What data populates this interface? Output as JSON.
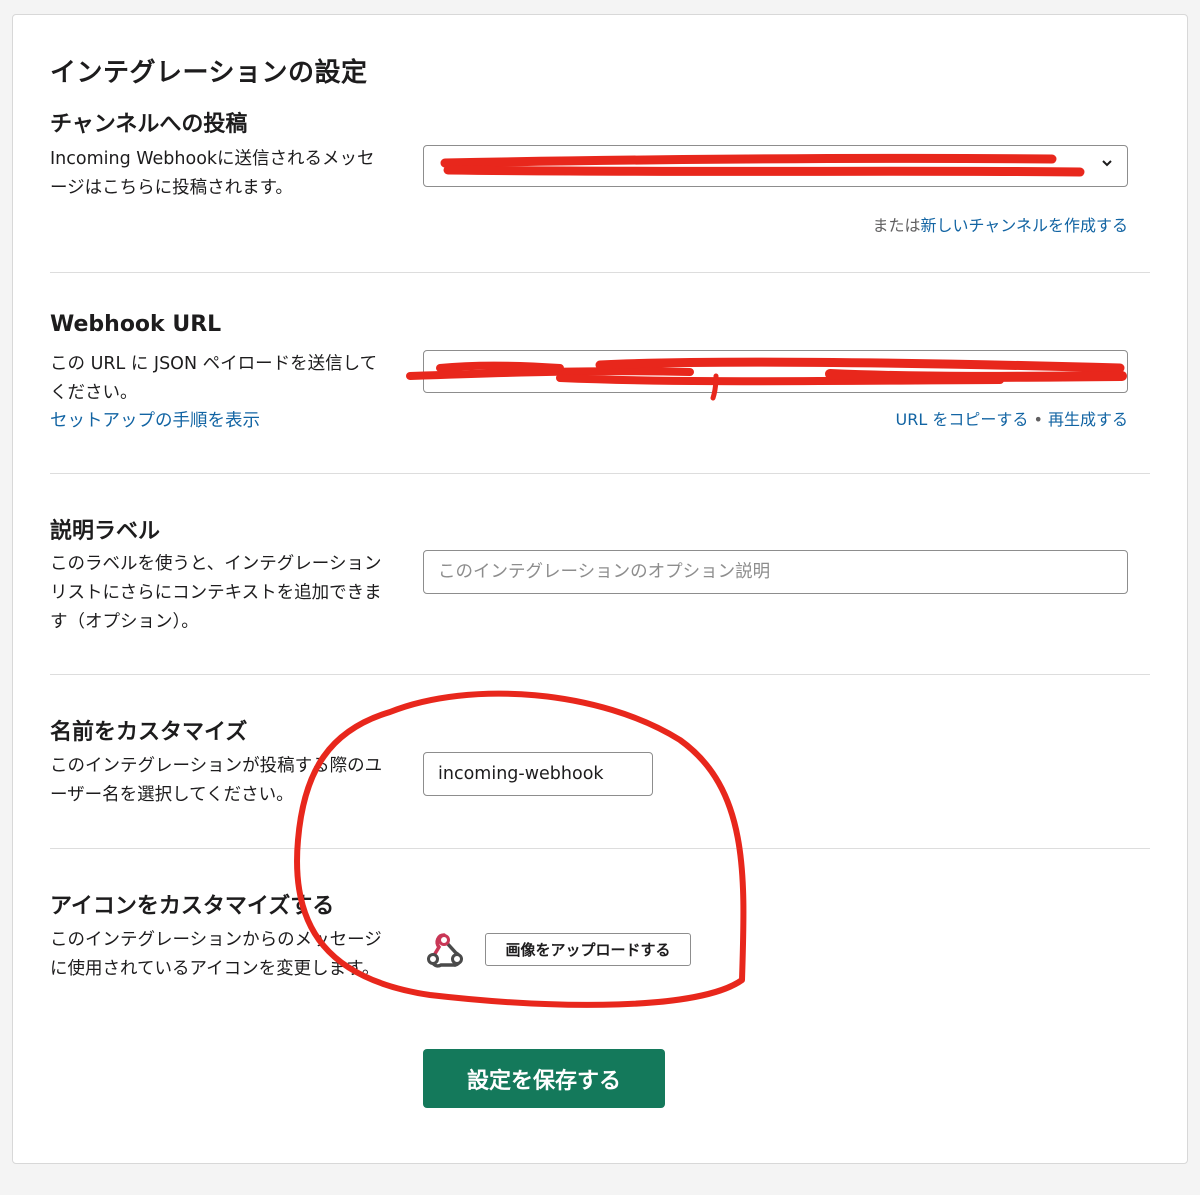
{
  "page": {
    "title": "インテグレーションの設定"
  },
  "channel_section": {
    "title": "チャンネルへの投稿",
    "description": "Incoming Webhookに送信されるメッセージはこちらに投稿されます。",
    "alt_prefix": "または",
    "create_channel_link": "新しいチャンネルを作成する",
    "dropdown_icon": "chevron-down-icon"
  },
  "webhook_section": {
    "title": "Webhook URL",
    "description": "この URL に JSON ペイロードを送信してください。",
    "setup_link": "セットアップの手順を表示",
    "copy_link": "URL をコピーする",
    "separator": "•",
    "regenerate_link": "再生成する"
  },
  "label_section": {
    "title": "説明ラベル",
    "description": "このラベルを使うと、インテグレーションリストにさらにコンテキストを追加できます（オプション）。",
    "placeholder": "このインテグレーションのオプション説明",
    "value": ""
  },
  "name_section": {
    "title": "名前をカスタマイズ",
    "description": "このインテグレーションが投稿する際のユーザー名を選択してください。",
    "value": "incoming-webhook"
  },
  "icon_section": {
    "title": "アイコンをカスタマイズする",
    "description": "このインテグレーションからのメッセージに使用されているアイコンを変更します。",
    "icon": "webhook-icon",
    "upload_label": "画像をアップロードする"
  },
  "save_label": "設定を保存する",
  "colors": {
    "link": "#1264a3",
    "save_button": "#14795b",
    "annotation_red": "#e8271c"
  }
}
